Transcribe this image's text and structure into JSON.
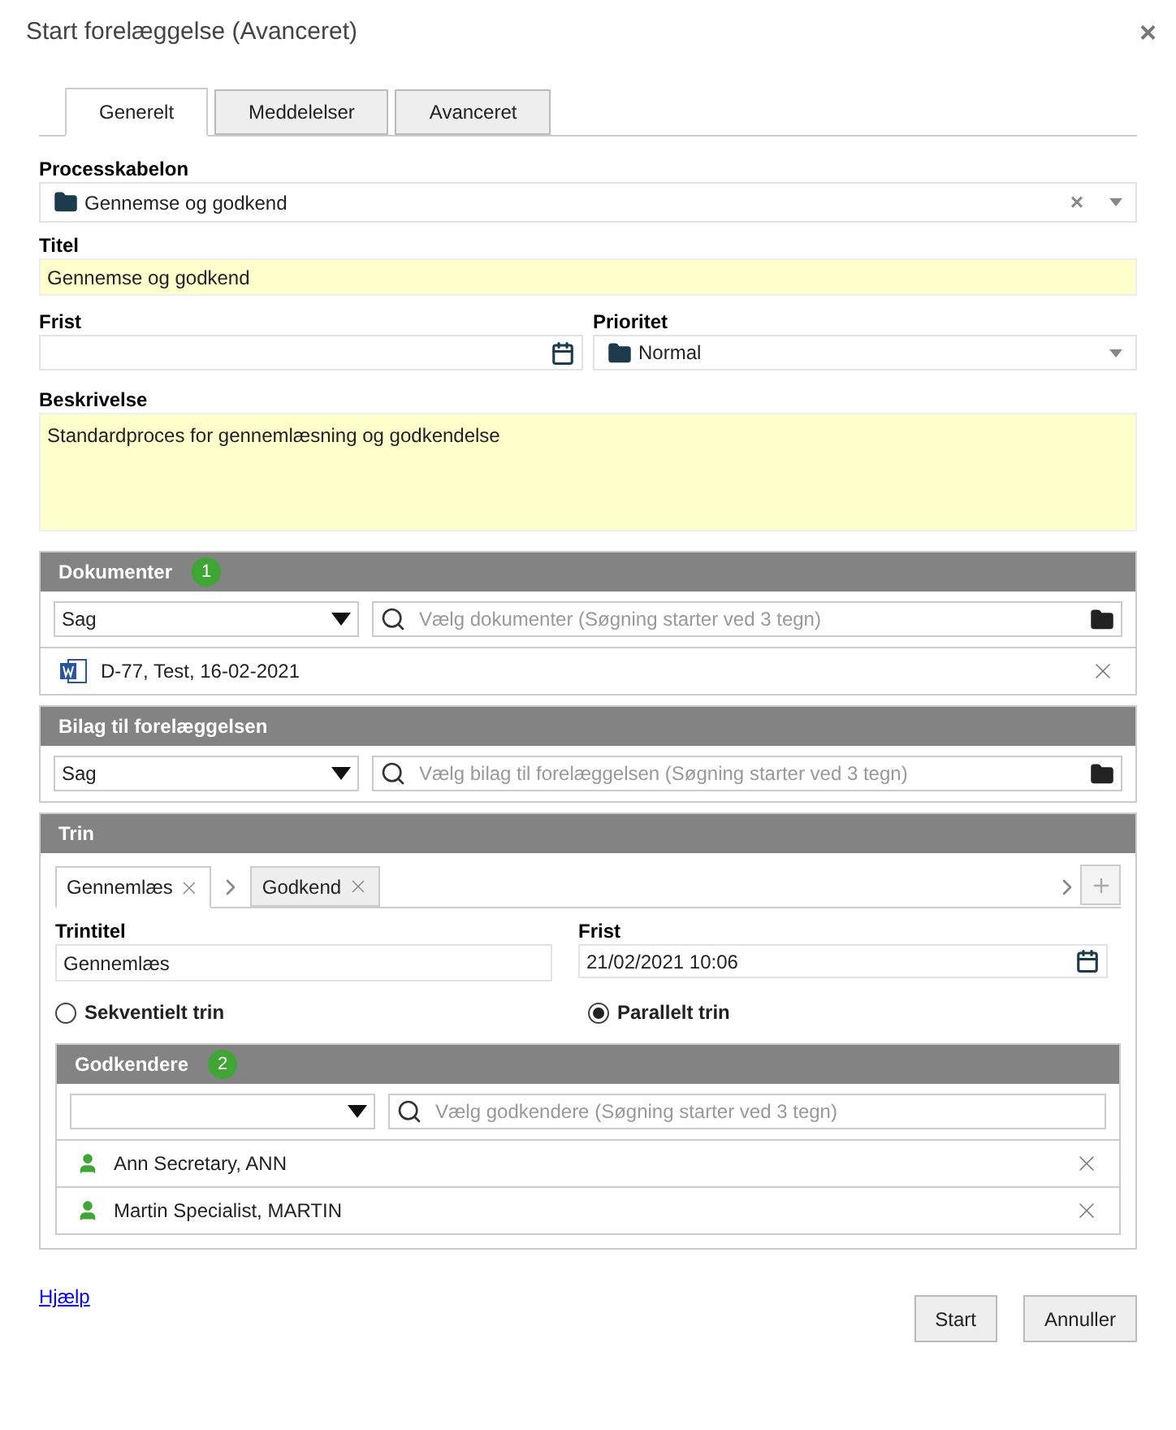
{
  "window": {
    "title": "Start forelæggelse (Avanceret)",
    "close": "×"
  },
  "tabs": [
    {
      "label": "Generelt",
      "selected": true
    },
    {
      "label": "Meddelelser",
      "selected": false
    },
    {
      "label": "Avanceret",
      "selected": false
    }
  ],
  "template": {
    "label": "Processkabelon",
    "value": "Gennemse og godkend",
    "clear": "×"
  },
  "title_field": {
    "label": "Titel",
    "value": "Gennemse og godkend"
  },
  "deadline": {
    "label": "Frist"
  },
  "priority": {
    "label": "Prioritet",
    "value": "Normal"
  },
  "description": {
    "label": "Beskrivelse",
    "value": "Standardproces for gennemlæsning og godkendelse"
  },
  "documents": {
    "title": "Dokumenter",
    "count": "1",
    "source": "Sag",
    "placeholder": "Vælg dokumenter (Søgning starter ved 3 tegn)",
    "items": [
      {
        "label": "D-77, Test, 16-02-2021"
      }
    ]
  },
  "attachments": {
    "title": "Bilag til forelæggelsen",
    "source": "Sag",
    "placeholder": "Vælg bilag til forelæggelsen (Søgning starter ved 3 tegn)"
  },
  "steps": {
    "title": "Trin",
    "tabs": [
      {
        "label": "Gennemlæs",
        "selected": true
      },
      {
        "label": "Godkend",
        "selected": false
      }
    ],
    "step_title": {
      "label": "Trintitel",
      "value": "Gennemlæs"
    },
    "deadline": {
      "label": "Frist",
      "value": "21/02/2021 10:06"
    },
    "modes": [
      {
        "label": "Sekventielt trin",
        "selected": false
      },
      {
        "label": "Parallelt trin",
        "selected": true
      }
    ],
    "approvers": {
      "title": "Godkendere",
      "count": "2",
      "placeholder": "Vælg godkendere (Søgning starter ved 3 tegn)",
      "items": [
        {
          "label": "Ann Secretary, ANN"
        },
        {
          "label": "Martin Specialist, MARTIN"
        }
      ]
    }
  },
  "help_link": "Hjælp",
  "buttons": [
    "Start",
    "Annuller"
  ]
}
